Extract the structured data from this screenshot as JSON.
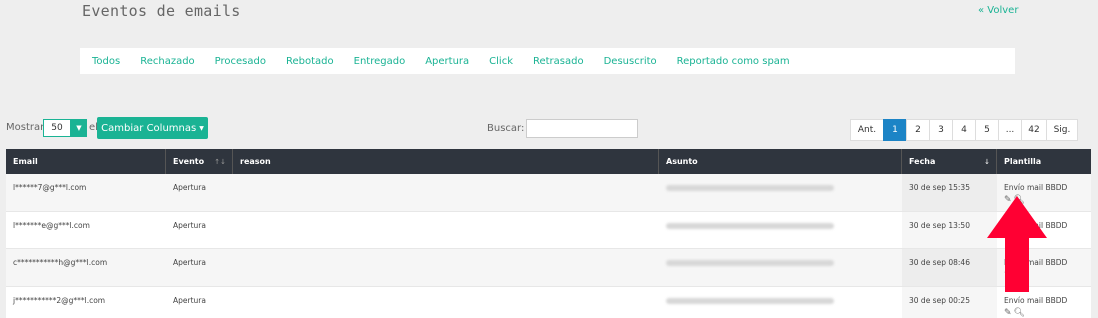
{
  "header": {
    "title": "Eventos de emails",
    "back_label": "« Volver"
  },
  "filters": [
    "Todos",
    "Rechazado",
    "Procesado",
    "Rebotado",
    "Entregado",
    "Apertura",
    "Click",
    "Retrasado",
    "Desuscrito",
    "Reportado como spam"
  ],
  "controls": {
    "show_label": "Mostrar",
    "page_size": "50",
    "show_suffix": "el",
    "columns_button": "Cambiar Columnas",
    "search_label": "Buscar:",
    "search_value": ""
  },
  "pagination": [
    "Ant.",
    "1",
    "2",
    "3",
    "4",
    "5",
    "...",
    "42",
    "Sig."
  ],
  "pagination_active": "1",
  "table": {
    "columns": [
      "Email",
      "Evento",
      "reason",
      "Asunto",
      "Fecha",
      "Plantilla"
    ],
    "rows": [
      {
        "email": "l******7@g***l.com",
        "evento": "Apertura",
        "reason": "",
        "fecha": "30 de sep 15:35",
        "plantilla": "Envío mail BBDD"
      },
      {
        "email": "l*******e@g***l.com",
        "evento": "Apertura",
        "reason": "",
        "fecha": "30 de sep 13:50",
        "plantilla": "Envío mail BBDD"
      },
      {
        "email": "c***********h@g***l.com",
        "evento": "Apertura",
        "reason": "",
        "fecha": "30 de sep 08:46",
        "plantilla": "Envío mail BBDD"
      },
      {
        "email": "j***********2@g***l.com",
        "evento": "Apertura",
        "reason": "",
        "fecha": "30 de sep 00:25",
        "plantilla": "Envío mail BBDD"
      }
    ]
  },
  "icons": {
    "edit": "pencil-icon",
    "view": "magnifier-icon",
    "sort": "sort-icon"
  },
  "colors": {
    "accent": "#1ab394",
    "active_page": "#1c84c6",
    "table_header": "#2f353e",
    "annotation_arrow": "#ff0033"
  }
}
